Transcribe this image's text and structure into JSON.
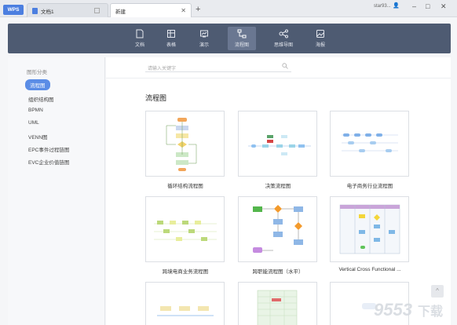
{
  "tabs": {
    "wps_label": "WPS",
    "doc_label": "文档1",
    "new_label": "新建"
  },
  "window": {
    "user_label": "star93...",
    "minimize": "–",
    "restore": "□",
    "close": "✕",
    "plus": "+"
  },
  "categories": [
    {
      "label": "文档",
      "icon": "document-icon"
    },
    {
      "label": "表格",
      "icon": "table-icon"
    },
    {
      "label": "演示",
      "icon": "presentation-icon"
    },
    {
      "label": "流程图",
      "icon": "flowchart-icon",
      "active": true
    },
    {
      "label": "思维导图",
      "icon": "mindmap-icon"
    },
    {
      "label": "海报",
      "icon": "poster-icon"
    }
  ],
  "sidebar": {
    "title": "图形分类",
    "items": [
      {
        "label": "流程图",
        "active": true
      },
      {
        "label": "组织结构图"
      },
      {
        "label": "BPMN"
      },
      {
        "label": "UML"
      },
      {
        "label": "VENN图"
      },
      {
        "label": "EPC事件过程链图"
      },
      {
        "label": "EVC企业价值链图"
      }
    ]
  },
  "search": {
    "placeholder": "请输入关键字"
  },
  "section": {
    "title": "流程图"
  },
  "templates": [
    {
      "label": "循环结构流程图"
    },
    {
      "label": "决策流程图"
    },
    {
      "label": "电子商务行业流程图"
    },
    {
      "label": "跨境电商业务流程图"
    },
    {
      "label": "跨职能流程图（水平）"
    },
    {
      "label": "Vertical Cross Functional ..."
    }
  ],
  "scroll_top": "^",
  "watermark": "9553下载",
  "colors": {
    "accent": "#5b8de6",
    "header": "#4e5b72"
  }
}
